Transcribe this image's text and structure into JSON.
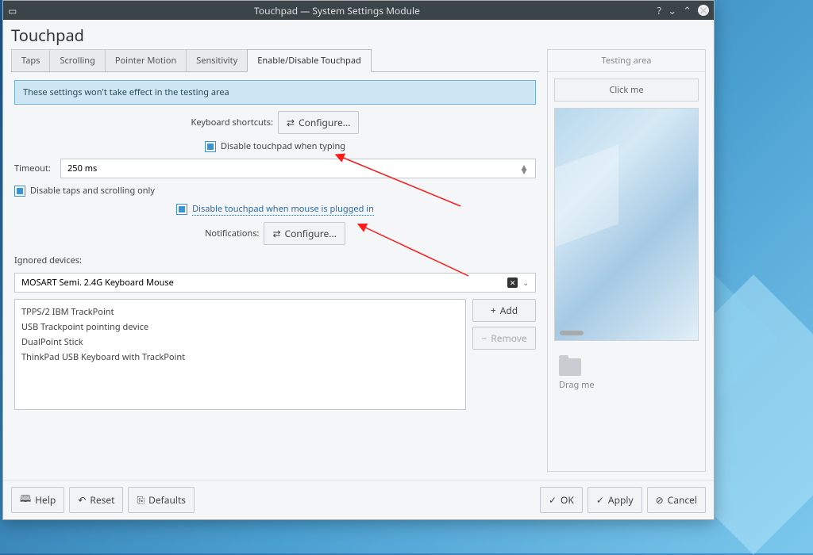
{
  "window": {
    "title": "Touchpad — System Settings Module"
  },
  "app": {
    "title": "Touchpad"
  },
  "tabs": {
    "items": [
      {
        "label": "Taps"
      },
      {
        "label": "Scrolling"
      },
      {
        "label": "Pointer Motion"
      },
      {
        "label": "Sensitivity"
      },
      {
        "label": "Enable/Disable Touchpad"
      }
    ],
    "activeIndex": 4
  },
  "info": "These settings won't take effect in the testing area",
  "keyboard": {
    "label": "Keyboard shortcuts:",
    "button": "Configure..."
  },
  "disableTyping": {
    "label": "Disable touchpad when typing"
  },
  "timeout": {
    "label": "Timeout:",
    "value": "250 ms"
  },
  "disableTaps": {
    "label": "Disable taps and scrolling only"
  },
  "disableMouse": {
    "label": "Disable touchpad when mouse is plugged in"
  },
  "notifications": {
    "label": "Notifications:",
    "button": "Configure..."
  },
  "ignored": {
    "label": "Ignored devices:",
    "current": "MOSART Semi. 2.4G Keyboard Mouse",
    "list": [
      "TPPS/2 IBM TrackPoint",
      "USB Trackpoint pointing device",
      "DualPoint Stick",
      "ThinkPad USB Keyboard with TrackPoint"
    ],
    "add": "Add",
    "remove": "Remove"
  },
  "testing": {
    "title": "Testing area",
    "click": "Click me",
    "drag": "Drag me"
  },
  "footer": {
    "help": "Help",
    "reset": "Reset",
    "defaults": "Defaults",
    "ok": "OK",
    "apply": "Apply",
    "cancel": "Cancel"
  }
}
